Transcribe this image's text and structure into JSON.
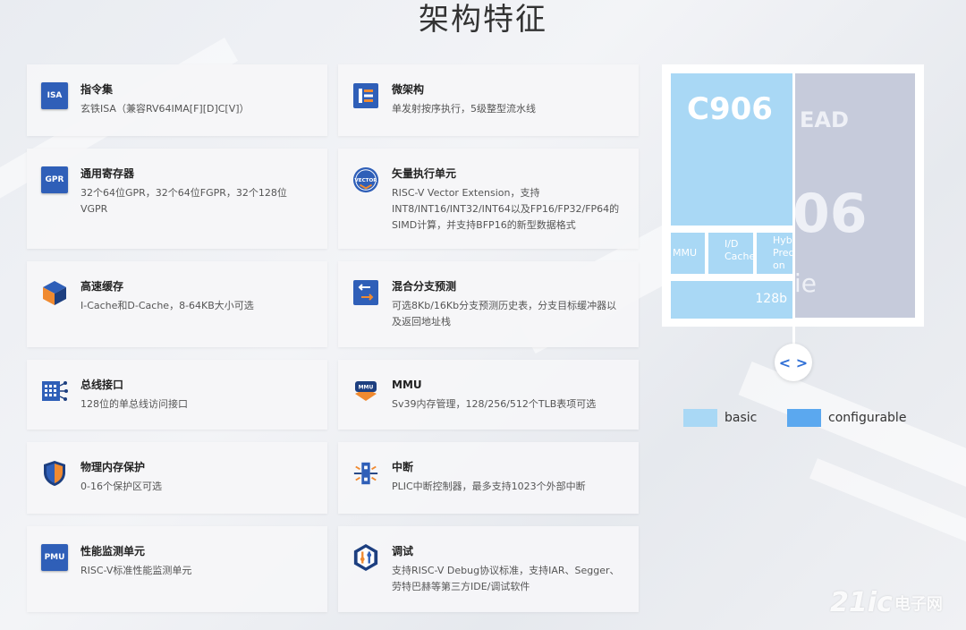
{
  "title": "架构特征",
  "features": [
    {
      "icon": "isa-icon",
      "icon_text": "ISA",
      "heading": "指令集",
      "desc": "玄铁ISA（兼容RV64IMA[F][D]C[V]）"
    },
    {
      "icon": "microarch-icon",
      "heading": "微架构",
      "desc": "单发射按序执行，5级整型流水线"
    },
    {
      "icon": "gpr-icon",
      "icon_text": "GPR",
      "heading": "通用寄存器",
      "desc": "32个64位GPR，32个64位FGPR，32个128位VGPR"
    },
    {
      "icon": "vector-icon",
      "icon_text": "VECTOR",
      "heading": "矢量执行单元",
      "desc": "RISC-V Vector Extension，支持INT8/INT16/INT32/INT64以及FP16/FP32/FP64的SIMD计算，并支持BFP16的新型数据格式"
    },
    {
      "icon": "cache-icon",
      "heading": "高速缓存",
      "desc": "I-Cache和D-Cache，8-64KB大小可选"
    },
    {
      "icon": "branch-predict-icon",
      "heading": "混合分支预测",
      "desc": "可选8Kb/16Kb分支预测历史表，分支目标缓冲器以及返回地址栈"
    },
    {
      "icon": "bus-icon",
      "heading": "总线接口",
      "desc": "128位的单总线访问接口"
    },
    {
      "icon": "mmu-icon",
      "icon_text": "MMU",
      "heading": "MMU",
      "desc": "Sv39内存管理，128/256/512个TLB表项可选"
    },
    {
      "icon": "shield-icon",
      "heading": "物理内存保护",
      "desc": "0-16个保护区可选"
    },
    {
      "icon": "interrupt-icon",
      "heading": "中断",
      "desc": "PLIC中断控制器，最多支持1023个外部中断"
    },
    {
      "icon": "pmu-icon",
      "icon_text": "PMU",
      "heading": "性能监测单元",
      "desc": "RISC-V标准性能监测单元"
    },
    {
      "icon": "debug-icon",
      "heading": "调试",
      "desc": "支持RISC-V Debug协议标准，支持IAR、Segger、劳特巴赫等第三方IDE/调试软件"
    }
  ],
  "diagram": {
    "core_name": "C906",
    "mmu_label": "MMU",
    "cache_label": "I/D Cache",
    "hybrid_label": "Hyb Pred on",
    "width_label": "128b",
    "right_title": "EAD",
    "right_big": "06",
    "right_sub": "ie"
  },
  "slider": {
    "icon": "code-arrows-icon",
    "glyph": "< >"
  },
  "legend": [
    {
      "label": "basic",
      "color": "#a9d8f5"
    },
    {
      "label": "configurable",
      "color": "#5ba8ef"
    }
  ],
  "watermark": {
    "brand": "21ic",
    "cn": "电子网"
  },
  "colors": {
    "accent": "#2f5fb8",
    "basic": "#a9d8f5",
    "configurable": "#5ba8ef"
  }
}
